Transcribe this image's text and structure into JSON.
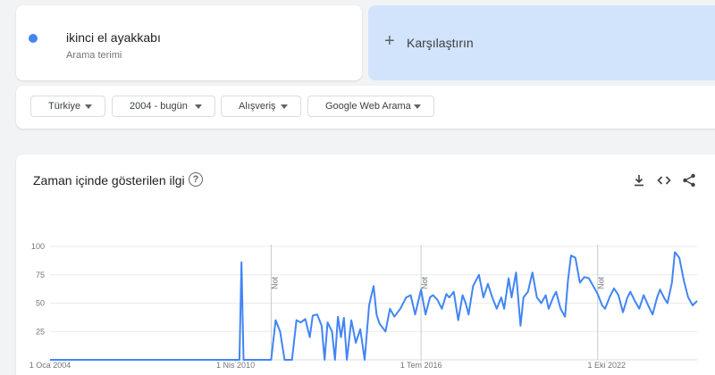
{
  "term": {
    "name": "ikinci el ayakkabı",
    "subtitle": "Arama terimi",
    "color": "#4285f4"
  },
  "compare": {
    "label": "Karşılaştırın"
  },
  "filters": [
    {
      "label": "Türkiye"
    },
    {
      "label": "2004 - bugün"
    },
    {
      "label": "Alışveriş"
    },
    {
      "label": "Google Web Arama"
    }
  ],
  "panel": {
    "title": "Zaman içinde gösterilen ilgi",
    "help_icon": "question-circle-icon",
    "tools": [
      "download-icon",
      "embed-code-icon",
      "share-icon"
    ]
  },
  "chart_data": {
    "type": "line",
    "ylim": [
      0,
      100
    ],
    "yticks": [
      25,
      50,
      75,
      100
    ],
    "x_labels": [
      "1 Oca 2004",
      "1 Nis 2010",
      "1 Tem 2016",
      "1 Eki 2022"
    ],
    "xlim": [
      2004.0,
      2025.8
    ],
    "notes": [
      {
        "x": 2011.45,
        "text": "Not"
      },
      {
        "x": 2016.5,
        "text": "Not"
      },
      {
        "x": 2022.45,
        "text": "Not"
      }
    ],
    "grid": true,
    "series": [
      {
        "color": "#4285f4",
        "points": [
          [
            2004.0,
            0
          ],
          [
            2010.2,
            0
          ],
          [
            2010.38,
            0
          ],
          [
            2010.45,
            86
          ],
          [
            2010.52,
            0
          ],
          [
            2011.35,
            0
          ],
          [
            2011.45,
            0
          ],
          [
            2011.6,
            35
          ],
          [
            2011.75,
            25
          ],
          [
            2011.9,
            0
          ],
          [
            2012.15,
            0
          ],
          [
            2012.3,
            35
          ],
          [
            2012.45,
            33
          ],
          [
            2012.6,
            36
          ],
          [
            2012.75,
            20
          ],
          [
            2012.85,
            39
          ],
          [
            2013.0,
            40
          ],
          [
            2013.15,
            30
          ],
          [
            2013.25,
            0
          ],
          [
            2013.35,
            33
          ],
          [
            2013.5,
            25
          ],
          [
            2013.6,
            0
          ],
          [
            2013.7,
            38
          ],
          [
            2013.8,
            20
          ],
          [
            2013.9,
            37
          ],
          [
            2014.0,
            0
          ],
          [
            2014.15,
            35
          ],
          [
            2014.3,
            15
          ],
          [
            2014.45,
            27
          ],
          [
            2014.6,
            0
          ],
          [
            2014.75,
            48
          ],
          [
            2014.9,
            65
          ],
          [
            2015.0,
            40
          ],
          [
            2015.1,
            32
          ],
          [
            2015.3,
            25
          ],
          [
            2015.45,
            45
          ],
          [
            2015.6,
            38
          ],
          [
            2015.8,
            45
          ],
          [
            2016.0,
            55
          ],
          [
            2016.15,
            57
          ],
          [
            2016.3,
            40
          ],
          [
            2016.5,
            62
          ],
          [
            2016.65,
            40
          ],
          [
            2016.8,
            55
          ],
          [
            2016.9,
            57
          ],
          [
            2017.05,
            53
          ],
          [
            2017.2,
            45
          ],
          [
            2017.35,
            58
          ],
          [
            2017.45,
            55
          ],
          [
            2017.6,
            60
          ],
          [
            2017.75,
            35
          ],
          [
            2017.9,
            57
          ],
          [
            2018.0,
            50
          ],
          [
            2018.1,
            40
          ],
          [
            2018.25,
            65
          ],
          [
            2018.45,
            75
          ],
          [
            2018.6,
            55
          ],
          [
            2018.75,
            67
          ],
          [
            2018.9,
            55
          ],
          [
            2019.05,
            45
          ],
          [
            2019.2,
            55
          ],
          [
            2019.3,
            45
          ],
          [
            2019.45,
            72
          ],
          [
            2019.55,
            55
          ],
          [
            2019.7,
            77
          ],
          [
            2019.85,
            30
          ],
          [
            2019.95,
            55
          ],
          [
            2020.1,
            60
          ],
          [
            2020.25,
            77
          ],
          [
            2020.4,
            55
          ],
          [
            2020.55,
            50
          ],
          [
            2020.7,
            57
          ],
          [
            2020.8,
            45
          ],
          [
            2020.95,
            55
          ],
          [
            2021.05,
            60
          ],
          [
            2021.2,
            45
          ],
          [
            2021.35,
            38
          ],
          [
            2021.45,
            70
          ],
          [
            2021.55,
            92
          ],
          [
            2021.7,
            90
          ],
          [
            2021.85,
            68
          ],
          [
            2022.0,
            73
          ],
          [
            2022.15,
            72
          ],
          [
            2022.3,
            65
          ],
          [
            2022.45,
            58
          ],
          [
            2022.6,
            48
          ],
          [
            2022.7,
            45
          ],
          [
            2022.85,
            55
          ],
          [
            2023.0,
            63
          ],
          [
            2023.15,
            57
          ],
          [
            2023.3,
            42
          ],
          [
            2023.45,
            55
          ],
          [
            2023.55,
            60
          ],
          [
            2023.7,
            52
          ],
          [
            2023.85,
            45
          ],
          [
            2024.0,
            57
          ],
          [
            2024.15,
            48
          ],
          [
            2024.3,
            40
          ],
          [
            2024.45,
            55
          ],
          [
            2024.55,
            62
          ],
          [
            2024.7,
            54
          ],
          [
            2024.8,
            50
          ],
          [
            2024.95,
            68
          ],
          [
            2025.05,
            95
          ],
          [
            2025.2,
            90
          ],
          [
            2025.35,
            70
          ],
          [
            2025.5,
            55
          ],
          [
            2025.65,
            48
          ],
          [
            2025.8,
            52
          ]
        ]
      }
    ]
  }
}
